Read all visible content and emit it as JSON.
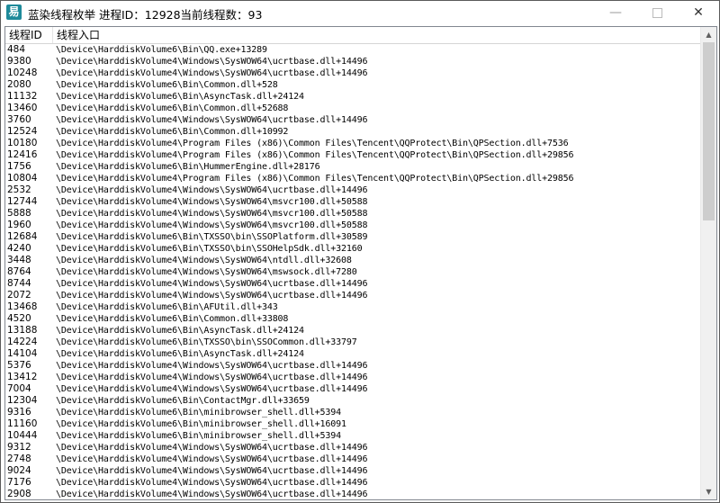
{
  "window": {
    "title": "蓝染线程枚举  进程ID：12928当前线程数：93",
    "icon_name": "app-icon",
    "icon_glyph": "易",
    "minimize_glyph": "—",
    "close_glyph": "✕"
  },
  "table": {
    "columns": [
      "线程ID",
      "线程入口"
    ],
    "rows": [
      [
        "484",
        "\\Device\\HarddiskVolume6\\Bin\\QQ.exe+13289"
      ],
      [
        "9380",
        "\\Device\\HarddiskVolume4\\Windows\\SysWOW64\\ucrtbase.dll+14496"
      ],
      [
        "10248",
        "\\Device\\HarddiskVolume4\\Windows\\SysWOW64\\ucrtbase.dll+14496"
      ],
      [
        "2080",
        "\\Device\\HarddiskVolume6\\Bin\\Common.dll+528"
      ],
      [
        "11132",
        "\\Device\\HarddiskVolume6\\Bin\\AsyncTask.dll+24124"
      ],
      [
        "13460",
        "\\Device\\HarddiskVolume6\\Bin\\Common.dll+52688"
      ],
      [
        "3760",
        "\\Device\\HarddiskVolume4\\Windows\\SysWOW64\\ucrtbase.dll+14496"
      ],
      [
        "12524",
        "\\Device\\HarddiskVolume6\\Bin\\Common.dll+10992"
      ],
      [
        "10180",
        "\\Device\\HarddiskVolume4\\Program Files (x86)\\Common Files\\Tencent\\QQProtect\\Bin\\QPSection.dll+7536"
      ],
      [
        "12416",
        "\\Device\\HarddiskVolume4\\Program Files (x86)\\Common Files\\Tencent\\QQProtect\\Bin\\QPSection.dll+29856"
      ],
      [
        "1756",
        "\\Device\\HarddiskVolume6\\Bin\\HummerEngine.dll+28176"
      ],
      [
        "10804",
        "\\Device\\HarddiskVolume4\\Program Files (x86)\\Common Files\\Tencent\\QQProtect\\Bin\\QPSection.dll+29856"
      ],
      [
        "2532",
        "\\Device\\HarddiskVolume4\\Windows\\SysWOW64\\ucrtbase.dll+14496"
      ],
      [
        "12744",
        "\\Device\\HarddiskVolume4\\Windows\\SysWOW64\\msvcr100.dll+50588"
      ],
      [
        "5888",
        "\\Device\\HarddiskVolume4\\Windows\\SysWOW64\\msvcr100.dll+50588"
      ],
      [
        "1960",
        "\\Device\\HarddiskVolume4\\Windows\\SysWOW64\\msvcr100.dll+50588"
      ],
      [
        "12684",
        "\\Device\\HarddiskVolume6\\Bin\\TXSSO\\bin\\SSOPlatform.dll+30589"
      ],
      [
        "4240",
        "\\Device\\HarddiskVolume6\\Bin\\TXSSO\\bin\\SSOHelpSdk.dll+32160"
      ],
      [
        "3448",
        "\\Device\\HarddiskVolume4\\Windows\\SysWOW64\\ntdll.dll+32608"
      ],
      [
        "8764",
        "\\Device\\HarddiskVolume4\\Windows\\SysWOW64\\mswsock.dll+7280"
      ],
      [
        "8744",
        "\\Device\\HarddiskVolume4\\Windows\\SysWOW64\\ucrtbase.dll+14496"
      ],
      [
        "2072",
        "\\Device\\HarddiskVolume4\\Windows\\SysWOW64\\ucrtbase.dll+14496"
      ],
      [
        "13468",
        "\\Device\\HarddiskVolume6\\Bin\\AFUtil.dll+343"
      ],
      [
        "4520",
        "\\Device\\HarddiskVolume6\\Bin\\Common.dll+33808"
      ],
      [
        "13188",
        "\\Device\\HarddiskVolume6\\Bin\\AsyncTask.dll+24124"
      ],
      [
        "14224",
        "\\Device\\HarddiskVolume6\\Bin\\TXSSO\\bin\\SSOCommon.dll+33797"
      ],
      [
        "14104",
        "\\Device\\HarddiskVolume6\\Bin\\AsyncTask.dll+24124"
      ],
      [
        "5376",
        "\\Device\\HarddiskVolume4\\Windows\\SysWOW64\\ucrtbase.dll+14496"
      ],
      [
        "13412",
        "\\Device\\HarddiskVolume4\\Windows\\SysWOW64\\ucrtbase.dll+14496"
      ],
      [
        "7004",
        "\\Device\\HarddiskVolume4\\Windows\\SysWOW64\\ucrtbase.dll+14496"
      ],
      [
        "12304",
        "\\Device\\HarddiskVolume6\\Bin\\ContactMgr.dll+33659"
      ],
      [
        "9316",
        "\\Device\\HarddiskVolume6\\Bin\\minibrowser_shell.dll+5394"
      ],
      [
        "11160",
        "\\Device\\HarddiskVolume6\\Bin\\minibrowser_shell.dll+16091"
      ],
      [
        "10444",
        "\\Device\\HarddiskVolume6\\Bin\\minibrowser_shell.dll+5394"
      ],
      [
        "9312",
        "\\Device\\HarddiskVolume4\\Windows\\SysWOW64\\ucrtbase.dll+14496"
      ],
      [
        "2748",
        "\\Device\\HarddiskVolume4\\Windows\\SysWOW64\\ucrtbase.dll+14496"
      ],
      [
        "9024",
        "\\Device\\HarddiskVolume4\\Windows\\SysWOW64\\ucrtbase.dll+14496"
      ],
      [
        "7176",
        "\\Device\\HarddiskVolume4\\Windows\\SysWOW64\\ucrtbase.dll+14496"
      ],
      [
        "2908",
        "\\Device\\HarddiskVolume4\\Windows\\SysWOW64\\ucrtbase.dll+14496"
      ]
    ]
  },
  "scrollbar": {
    "up_glyph": "▲",
    "down_glyph": "▼"
  }
}
